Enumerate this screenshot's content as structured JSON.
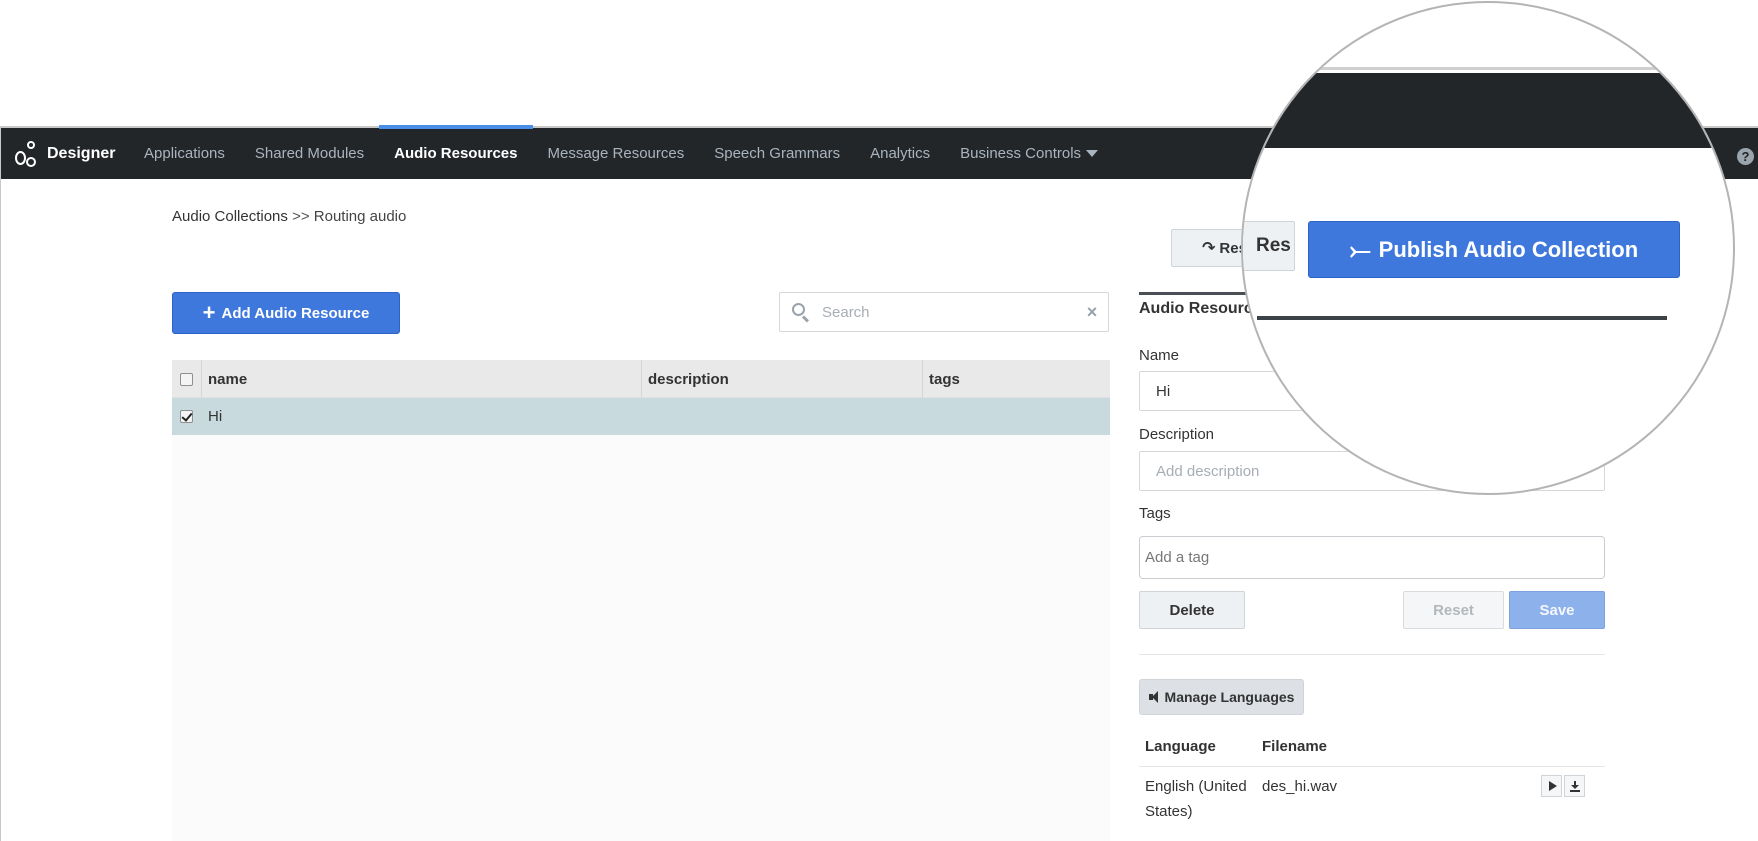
{
  "brand": {
    "name": "Designer"
  },
  "nav": {
    "items": [
      {
        "label": "Applications",
        "active": false
      },
      {
        "label": "Shared Modules",
        "active": false
      },
      {
        "label": "Audio Resources",
        "active": true
      },
      {
        "label": "Message Resources",
        "active": false
      },
      {
        "label": "Speech Grammars",
        "active": false
      },
      {
        "label": "Analytics",
        "active": false
      },
      {
        "label": "Business Controls",
        "active": false
      }
    ],
    "help": "?"
  },
  "breadcrumb": {
    "root": "Audio Collections",
    "separator": ">>",
    "current": "Routing audio"
  },
  "toolbar": {
    "add_label": "Add Audio Resource",
    "add_icon": "+"
  },
  "search": {
    "placeholder": "Search",
    "clear": "×"
  },
  "table": {
    "columns": [
      "name",
      "description",
      "tags"
    ],
    "rows": [
      {
        "name": "Hi",
        "description": "",
        "tags": "",
        "checked": true
      }
    ]
  },
  "panel": {
    "title": "Audio Resource",
    "name_label": "Name",
    "name_value": "Hi",
    "description_label": "Description",
    "description_placeholder": "Add description",
    "tags_label": "Tags",
    "tags_placeholder": "Add a tag",
    "delete_label": "Delete",
    "reset_label": "Reset",
    "save_label": "Save",
    "manage_languages_label": "Manage Languages",
    "lang_table": {
      "headers": [
        "Language",
        "Filename"
      ],
      "rows": [
        {
          "language": "English (United States)",
          "filename": "des_hi.wav"
        }
      ]
    }
  },
  "header_actions": {
    "refresh_partial": "Res",
    "publish_label": "Publish Audio Collection"
  },
  "colors": {
    "navbar": "#232629",
    "accent": "#3f78dc",
    "active_tab": "#4a8fe7",
    "selected_row": "#c8dade"
  }
}
